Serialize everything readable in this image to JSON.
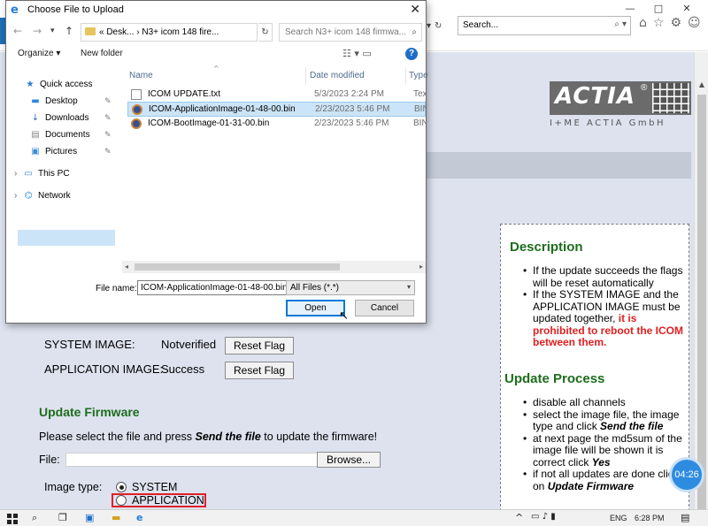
{
  "browser": {
    "search_placeholder": "Search...",
    "search_icons": "⌕ ▾",
    "window_controls": {
      "minimize": "—",
      "maximize": "□",
      "close": "✕"
    },
    "address_tail": {
      "dropdown": "▾",
      "refresh": "↻"
    },
    "toolbar_icons": {
      "home": "⌂",
      "favorites": "☆",
      "settings": "⚙",
      "smiley": "☺"
    }
  },
  "page": {
    "logo": {
      "word": "ACTIA",
      "registered": "®",
      "tagline": "I+ME ACTIA GmbH"
    },
    "description": {
      "title": "Description",
      "items": [
        {
          "text": "If the update succeeds the flags will be reset automatically"
        },
        {
          "text": "If the SYSTEM IMAGE and the APPLICATION IMAGE must be updated together, ",
          "red": "it is prohibited to reboot the ICOM between them."
        }
      ]
    },
    "update_process": {
      "title": "Update Process",
      "items": [
        {
          "text": "disable all channels"
        },
        {
          "text": "select the image file, the image type and click ",
          "bold": "Send the file"
        },
        {
          "text": "at next page the md5sum of the image file will be shown it is correct click ",
          "bold": "Yes"
        },
        {
          "text": "if not all updates are done click on ",
          "bold": "Update Firmware"
        }
      ]
    },
    "flags": [
      {
        "label": "SYSTEM IMAGE:",
        "status": "Notverified",
        "button": "Reset Flag"
      },
      {
        "label": "APPLICATION IMAGE:",
        "status": "Success",
        "button": "Reset Flag"
      }
    ],
    "update_firmware": {
      "title": "Update Firmware",
      "text_before": "Please select the file and press ",
      "text_bold": "Send the file",
      "text_after": " to update the firmware!",
      "file_label": "File:",
      "browse_button": "Browse...",
      "image_type_label": "Image type:",
      "options": [
        {
          "label": "SYSTEM",
          "checked": true
        },
        {
          "label": "APPLICATION",
          "checked": false
        }
      ]
    },
    "timer": "04:26"
  },
  "dialog": {
    "title": "Choose File to Upload",
    "close": "✕",
    "nav": {
      "back": "←",
      "forward": "→",
      "recent": "▾",
      "up": "↑"
    },
    "breadcrumb": "«  Desk...  ›  N3+ icom 148 fire...",
    "breadcrumb_dropdown": "▾",
    "refresh": "↻",
    "search_placeholder": "Search N3+ icom 148 firmwa...",
    "search_icon": "⌕",
    "organize": "Organize ▾",
    "new_folder": "New folder",
    "view_icons": "☷ ▾   ▭",
    "help": "?",
    "nav_pane": [
      {
        "label": "Quick access",
        "icon": "★",
        "icon_color": "#2b79d0",
        "pinned": false
      },
      {
        "label": "Desktop",
        "icon": "▬",
        "icon_color": "#2f86e0",
        "pinned": true
      },
      {
        "label": "Downloads",
        "icon": "↓",
        "icon_color": "#2b6fb8",
        "pinned": true
      },
      {
        "label": "Documents",
        "icon": "▤",
        "icon_color": "#8a8a8a",
        "pinned": true
      },
      {
        "label": "Pictures",
        "icon": "▣",
        "icon_color": "#3a8fd8",
        "pinned": true
      },
      {
        "label": "This PC",
        "icon": "▭",
        "icon_color": "#2f86e0",
        "pinned": false
      },
      {
        "label": "Network",
        "icon": "⌬",
        "icon_color": "#2f86e0",
        "pinned": false
      }
    ],
    "expand_arrow": "›",
    "pin_icon": "✎",
    "columns": {
      "name": "Name",
      "date": "Date modified",
      "type": "Type"
    },
    "sort_caret": "^",
    "files": [
      {
        "name": "ICOM UPDATE.txt",
        "date": "5/3/2023 2:24 PM",
        "type": "Text Document",
        "kind": "txt",
        "selected": false
      },
      {
        "name": "ICOM-ApplicationImage-01-48-00.bin",
        "date": "2/23/2023 5:46 PM",
        "type": "BIN File",
        "kind": "bin",
        "selected": true
      },
      {
        "name": "ICOM-BootImage-01-31-00.bin",
        "date": "2/23/2023 5:46 PM",
        "type": "BIN File",
        "kind": "bin",
        "selected": false
      }
    ],
    "hscroll": {
      "left": "◂",
      "right": "▸"
    },
    "file_name_label": "File name:",
    "file_name_value": "ICOM-ApplicationImage-01-48-00.bin",
    "filter": "All Files (*.*)",
    "filter_caret": "▾",
    "open_button": "Open",
    "cancel_button": "Cancel",
    "cursor": "↖"
  },
  "taskbar": {
    "search": "⌕",
    "task_view": "❐",
    "app1": "▣",
    "explorer": "▬",
    "ie": "e",
    "tray_caret": "^",
    "tray_icons": "▭ ♪ ▮",
    "language": "ENG",
    "time": "6:28 PM",
    "notifications": "▤"
  }
}
